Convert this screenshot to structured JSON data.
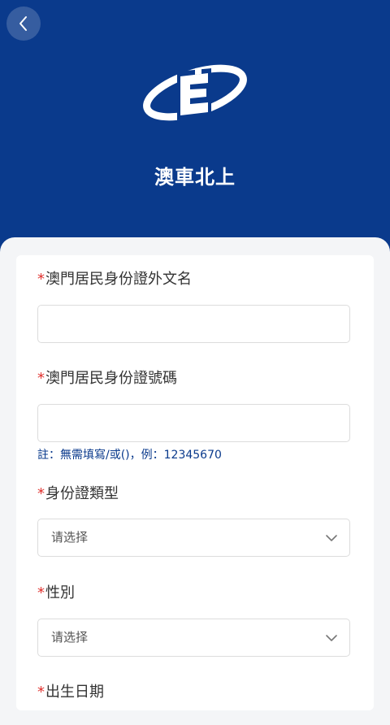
{
  "app": {
    "title": "澳車北上"
  },
  "colors": {
    "header_bg": "#0a3a8c",
    "required_marker": "#e0312e",
    "hint_text": "#0a3a8c"
  },
  "form": {
    "required_marker": "*",
    "fields": [
      {
        "label": "澳門居民身份證外文名",
        "value": ""
      },
      {
        "label": "澳門居民身份證號碼",
        "value": "",
        "hint": "註：無需填寫/或()，例：12345670"
      },
      {
        "label": "身份證類型",
        "selected": "请选择"
      },
      {
        "label": "性別",
        "selected": "请选择"
      },
      {
        "label": "出生日期"
      }
    ]
  },
  "icons": {
    "back": "chevron-left-icon",
    "dropdown": "chevron-down-icon",
    "logo": "macau-vehicle-logo"
  }
}
